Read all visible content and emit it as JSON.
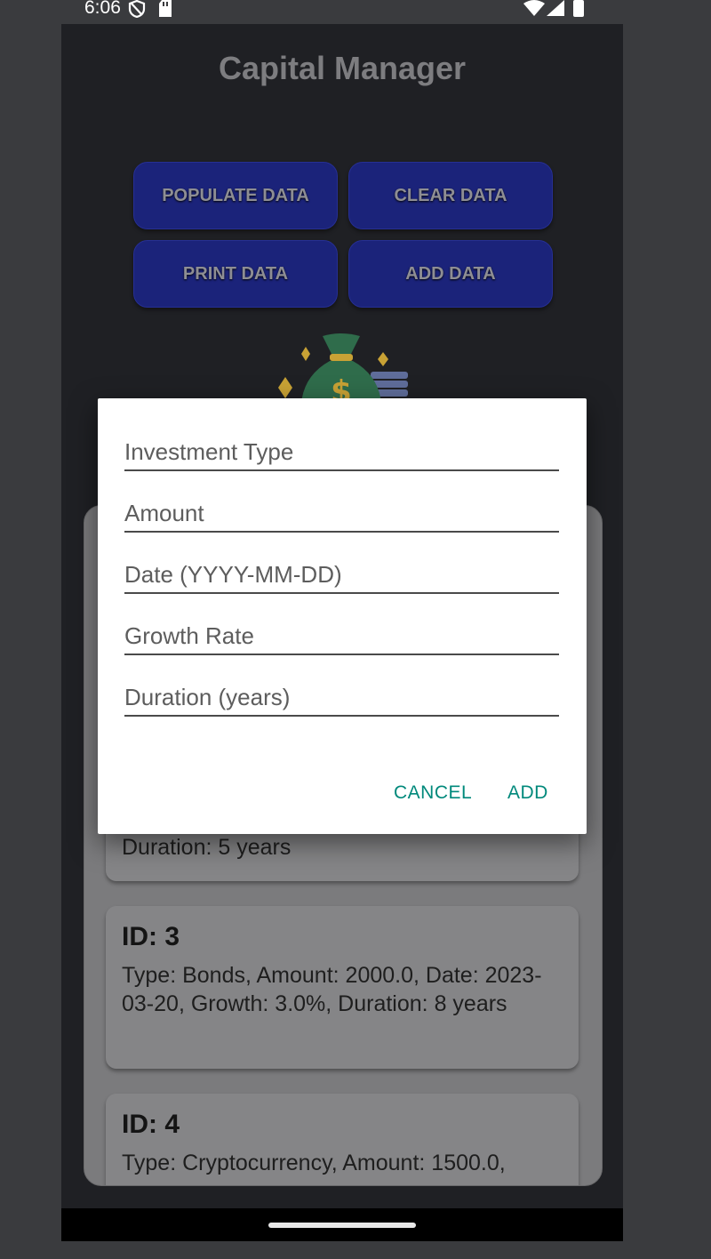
{
  "status_bar": {
    "time": "6:06"
  },
  "app": {
    "title": "Capital Manager"
  },
  "buttons": {
    "populate": "POPULATE DATA",
    "clear": "CLEAR DATA",
    "print": "PRINT DATA",
    "add": "ADD DATA"
  },
  "list": {
    "partial_item": {
      "text": "Duration: 5 years"
    },
    "items": [
      {
        "id": "ID: 3",
        "text": "Type: Bonds, Amount: 2000.0, Date: 2023-03-20, Growth: 3.0%, Duration: 8 years"
      },
      {
        "id": "ID: 4",
        "text": "Type: Cryptocurrency, Amount: 1500.0,"
      }
    ]
  },
  "dialog": {
    "fields": {
      "investment_type": {
        "placeholder": "Investment Type",
        "value": ""
      },
      "amount": {
        "placeholder": "Amount",
        "value": ""
      },
      "date": {
        "placeholder": "Date (YYYY-MM-DD)",
        "value": ""
      },
      "growth_rate": {
        "placeholder": "Growth Rate",
        "value": ""
      },
      "duration": {
        "placeholder": "Duration (years)",
        "value": ""
      }
    },
    "cancel_label": "CANCEL",
    "add_label": "ADD"
  },
  "colors": {
    "accent": "#00897b",
    "button_bg": "#1b237a",
    "background": "#1f2024"
  }
}
